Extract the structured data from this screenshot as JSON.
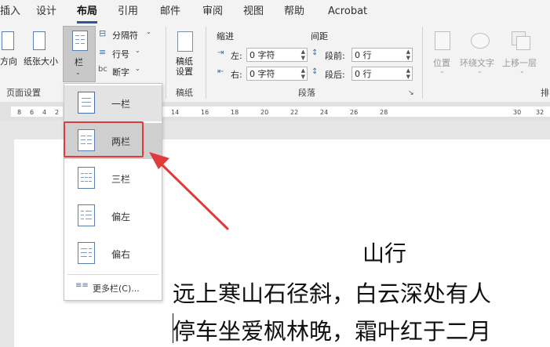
{
  "tabs": [
    "插入",
    "设计",
    "布局",
    "引用",
    "邮件",
    "审阅",
    "视图",
    "帮助",
    "Acrobat"
  ],
  "active_tab": "布局",
  "ribbon": {
    "page_setup": {
      "direction": "方向",
      "paper_size": "纸张大小",
      "columns": "栏",
      "breaks": "分隔符",
      "line_numbers": "行号",
      "hyphenation": "断字",
      "group_label": "页面设置"
    },
    "manuscript": {
      "button": "稿纸\n设置",
      "group_label": "稿纸"
    },
    "paragraph": {
      "indent_header": "缩进",
      "spacing_header": "间距",
      "left_label": "左:",
      "left_value": "0 字符",
      "right_label": "右:",
      "right_value": "0 字符",
      "before_label": "段前:",
      "before_value": "0 行",
      "after_label": "段后:",
      "after_value": "0 行",
      "group_label": "段落"
    },
    "arrange": {
      "position": "位置",
      "wrap_text": "环绕文字",
      "bring_forward": "上移一层",
      "group_label": "排"
    }
  },
  "ruler_ticks": [
    "8",
    "6",
    "4",
    "2",
    "14",
    "16",
    "18",
    "20",
    "22",
    "24",
    "26",
    "28",
    "30",
    "32"
  ],
  "columns_menu": {
    "items": [
      "一栏",
      "两栏",
      "三栏",
      "偏左",
      "偏右"
    ],
    "selected": "两栏",
    "more": "更多栏(C)..."
  },
  "document": {
    "title": "山行",
    "line1": "远上寒山石径斜，白云深处有人",
    "line2": "停车坐爱枫林晚，霜叶红于二月"
  },
  "colors": {
    "highlight_border": "#e03a3a",
    "arrow": "#e03a3a",
    "accent": "#2b579a"
  }
}
